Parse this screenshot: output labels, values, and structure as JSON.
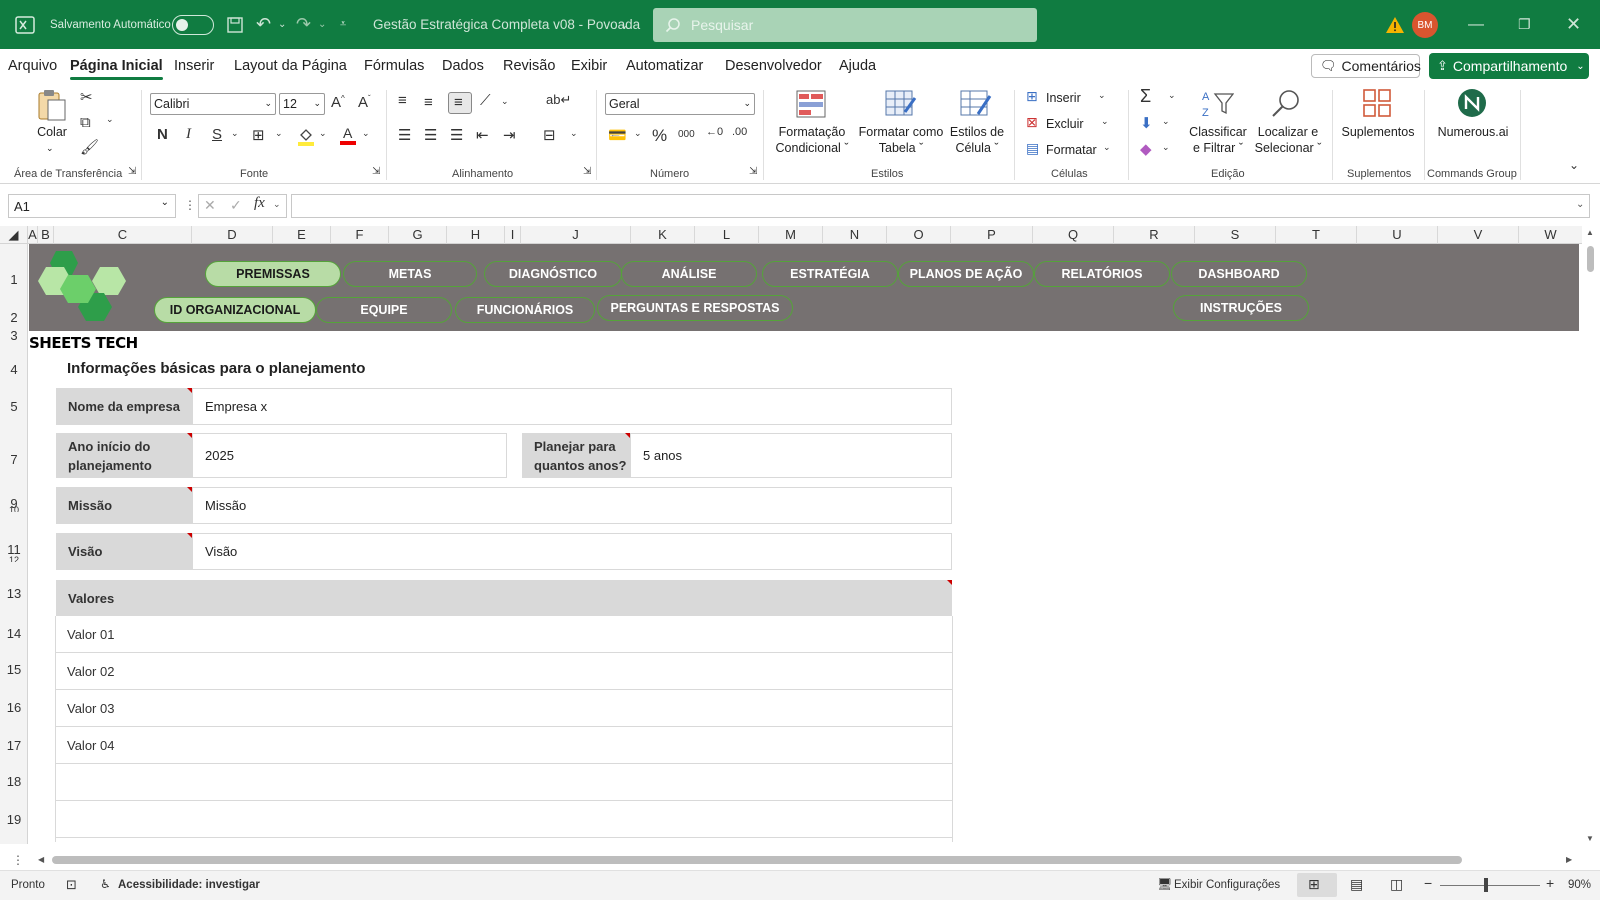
{
  "titlebar": {
    "autosave_label": "Salvamento Automático",
    "doc_title": "Gestão Estratégica Completa v08 - Povoada",
    "search_placeholder": "Pesquisar",
    "user_initials": "BM"
  },
  "menu": {
    "tabs": [
      "Arquivo",
      "Página Inicial",
      "Inserir",
      "Layout da Página",
      "Fórmulas",
      "Dados",
      "Revisão",
      "Exibir",
      "Automatizar",
      "Desenvolvedor",
      "Ajuda"
    ],
    "active": "Página Inicial",
    "comments_label": "Comentários",
    "share_label": "Compartilhamento"
  },
  "ribbon": {
    "clipboard": {
      "paste": "Colar",
      "label": "Área de Transferência"
    },
    "font": {
      "name": "Calibri",
      "size": "12",
      "bold": "N",
      "italic": "I",
      "underline": "S",
      "label": "Fonte"
    },
    "alignment": {
      "label": "Alinhamento"
    },
    "number": {
      "format": "Geral",
      "label": "Número"
    },
    "styles": {
      "cond_format_1": "Formatação",
      "cond_format_2": "Condicional",
      "format_table_1": "Formatar como",
      "format_table_2": "Tabela",
      "cell_styles_1": "Estilos de",
      "cell_styles_2": "Célula",
      "label": "Estilos"
    },
    "cells": {
      "insert": "Inserir",
      "delete": "Excluir",
      "format": "Formatar",
      "label": "Células"
    },
    "editing": {
      "sort_1": "Classificar",
      "sort_2": "e Filtrar",
      "find_1": "Localizar e",
      "find_2": "Selecionar",
      "label": "Edição"
    },
    "addins": {
      "button": "Suplementos",
      "label": "Suplementos"
    },
    "commands": {
      "button": "Numerous.ai",
      "label": "Commands Group"
    }
  },
  "formula_bar": {
    "name_box": "A1",
    "formula": ""
  },
  "columns": [
    "A",
    "B",
    "C",
    "D",
    "E",
    "F",
    "G",
    "H",
    "I",
    "J",
    "K",
    "L",
    "M",
    "N",
    "O",
    "P",
    "Q",
    "R",
    "S",
    "T",
    "U",
    "V",
    "W"
  ],
  "rows": [
    "1",
    "2",
    "3",
    "4",
    "5",
    "7",
    "9",
    "10",
    "11",
    "12",
    "13",
    "14",
    "15",
    "16",
    "17",
    "18",
    "19"
  ],
  "sheet": {
    "brand": "SHEETS TECH",
    "nav_row1": [
      "PREMISSAS",
      "METAS",
      "DIAGNÓSTICO",
      "ANÁLISE",
      "ESTRATÉGIA",
      "PLANOS DE AÇÃO",
      "RELATÓRIOS",
      "DASHBOARD"
    ],
    "nav_row2": [
      "ID ORGANIZACIONAL",
      "EQUIPE",
      "FUNCIONÁRIOS",
      "PERGUNTAS E RESPOSTAS",
      "INSTRUÇÕES"
    ],
    "heading": "Informações básicas para o planejamento",
    "company_label": "Nome da empresa",
    "company_value": "Empresa x",
    "start_year_label": "Ano início do planejamento",
    "start_year_value": "2025",
    "plan_years_label": "Planejar para quantos anos?",
    "plan_years_value": "5 anos",
    "mission_label": "Missão",
    "mission_value": "Missão",
    "vision_label": "Visão",
    "vision_value": "Visão",
    "values_header": "Valores",
    "values": [
      "Valor 01",
      "Valor 02",
      "Valor 03",
      "Valor 04",
      "",
      ""
    ]
  },
  "status": {
    "ready": "Pronto",
    "accessibility": "Acessibilidade: investigar",
    "display_settings": "Exibir Configurações",
    "zoom": "90%"
  },
  "colors": {
    "excel_green": "#107c41",
    "nav_band": "#767171",
    "pill_active": "#b8dca6",
    "label_gray": "#d9d9d9"
  }
}
